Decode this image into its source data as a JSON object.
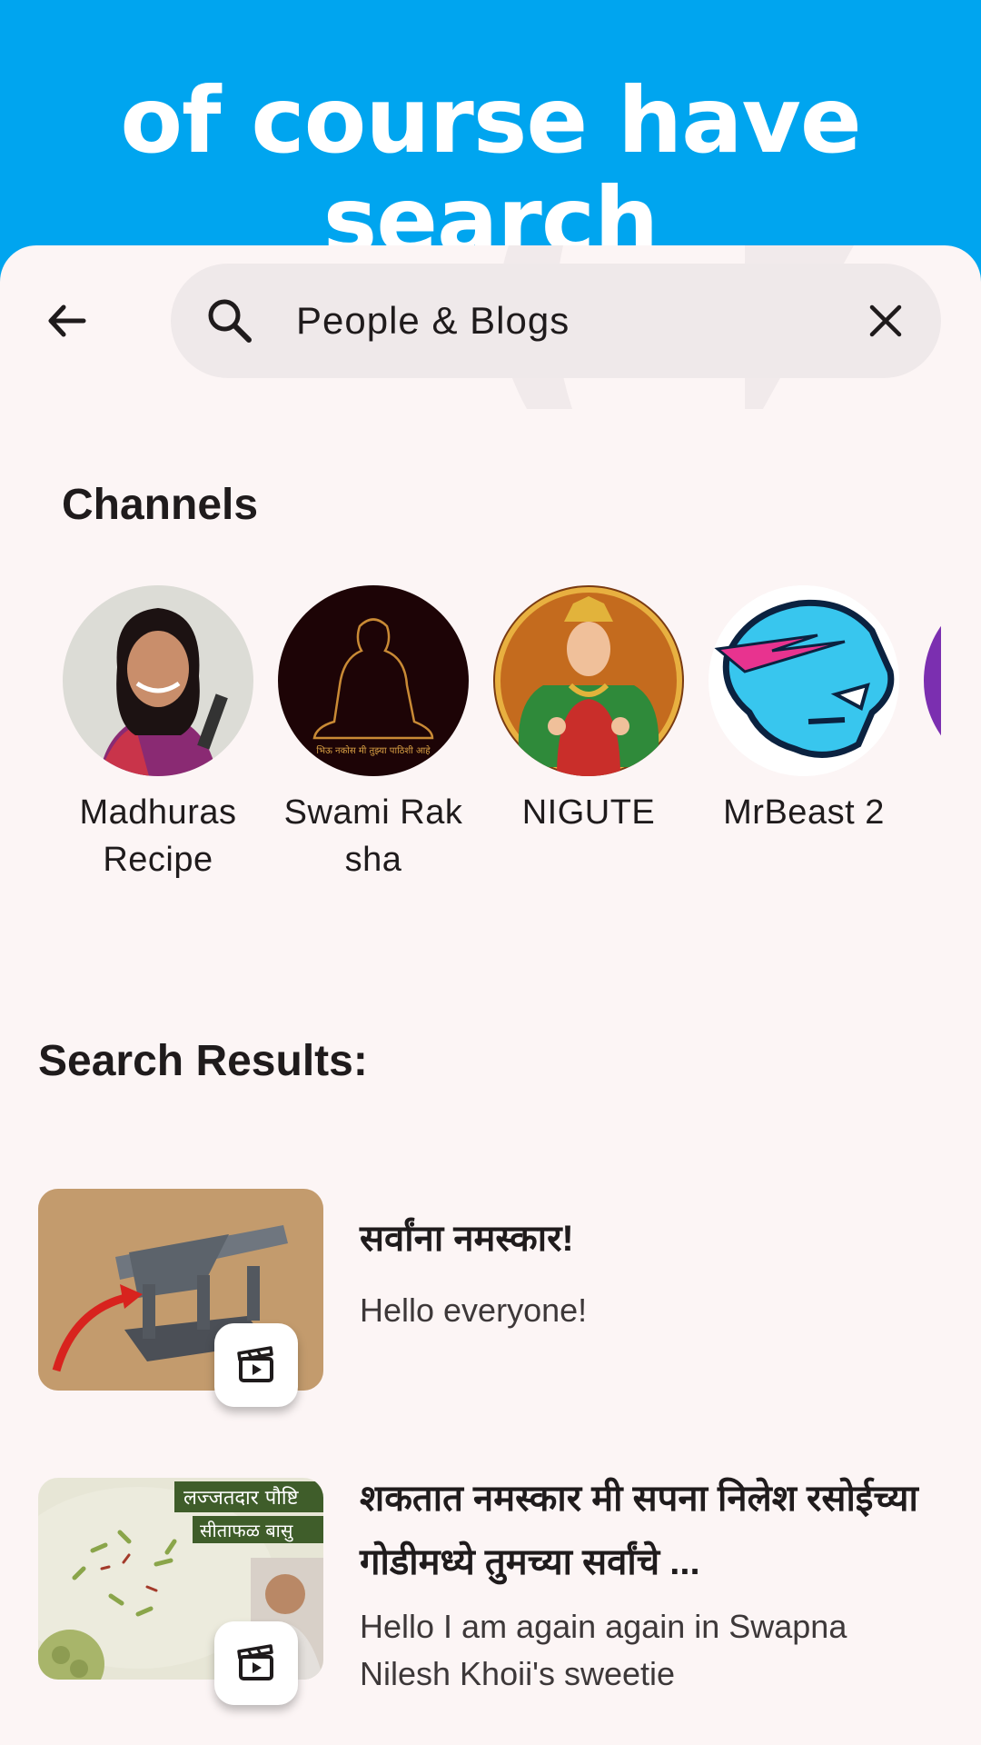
{
  "banner": {
    "title": "of course have search"
  },
  "search": {
    "query": "People & Blogs"
  },
  "channels": {
    "heading": "Channels",
    "items": [
      {
        "name": "MadhurasRecipe"
      },
      {
        "name": "Swami Raksha",
        "avatar_caption": "भिऊ नकोस मी तुझ्या पाठिशी आहे"
      },
      {
        "name": "NIGUTE"
      },
      {
        "name": "MrBeast 2"
      }
    ]
  },
  "results": {
    "heading": "Search Results:",
    "items": [
      {
        "title": "सर्वांना नमस्कार!",
        "subtitle": "Hello everyone!"
      },
      {
        "title": "शकतात नमस्कार मी सपना निलेश रसोईच्या गोडीमध्ये तुमच्या सर्वांचे ...",
        "subtitle": "Hello I am again again in Swapna Nilesh Khoii's sweetie",
        "thumb_text_1": "लज्जतदार पौष्टि",
        "thumb_text_2": "सीताफळ बासु"
      }
    ]
  },
  "colors": {
    "accent": "#00a5ef",
    "surface": "#fcf5f5",
    "searchbar": "#efe9ea"
  }
}
